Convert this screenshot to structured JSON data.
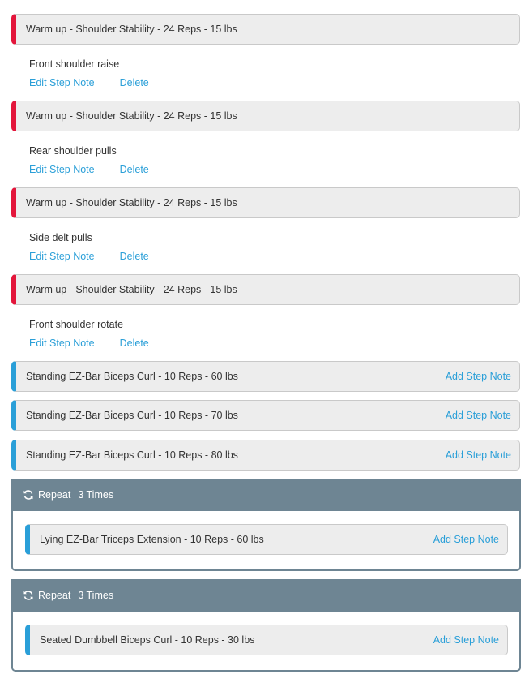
{
  "warmup_steps": [
    {
      "title": "Warm up - Shoulder Stability - 24 Reps - 15 lbs",
      "note": "Front shoulder raise"
    },
    {
      "title": "Warm up - Shoulder Stability - 24 Reps - 15 lbs",
      "note": "Rear shoulder pulls"
    },
    {
      "title": "Warm up - Shoulder Stability - 24 Reps - 15 lbs",
      "note": "Side delt pulls"
    },
    {
      "title": "Warm up - Shoulder Stability - 24 Reps - 15 lbs",
      "note": "Front shoulder rotate"
    }
  ],
  "note_actions": {
    "edit_label": "Edit Step Note",
    "delete_label": "Delete"
  },
  "main_steps": [
    {
      "title": "Standing EZ-Bar Biceps Curl - 10 Reps - 60 lbs"
    },
    {
      "title": "Standing EZ-Bar Biceps Curl - 10 Reps - 70 lbs"
    },
    {
      "title": "Standing EZ-Bar Biceps Curl - 10 Reps - 80 lbs"
    }
  ],
  "add_note_label": "Add Step Note",
  "repeat_blocks": [
    {
      "label": "Repeat",
      "count": "3 Times",
      "icon": "refresh-icon",
      "step": "Lying EZ-Bar Triceps Extension - 10 Reps - 60 lbs"
    },
    {
      "label": "Repeat",
      "count": "3 Times",
      "icon": "refresh-icon",
      "step": "Seated Dumbbell Biceps Curl - 10 Reps - 30 lbs"
    }
  ],
  "colors": {
    "warmup_accent": "#e3163b",
    "main_accent": "#2a9fd8",
    "repeat_header": "#6e8593",
    "link": "#2a9fd8"
  }
}
